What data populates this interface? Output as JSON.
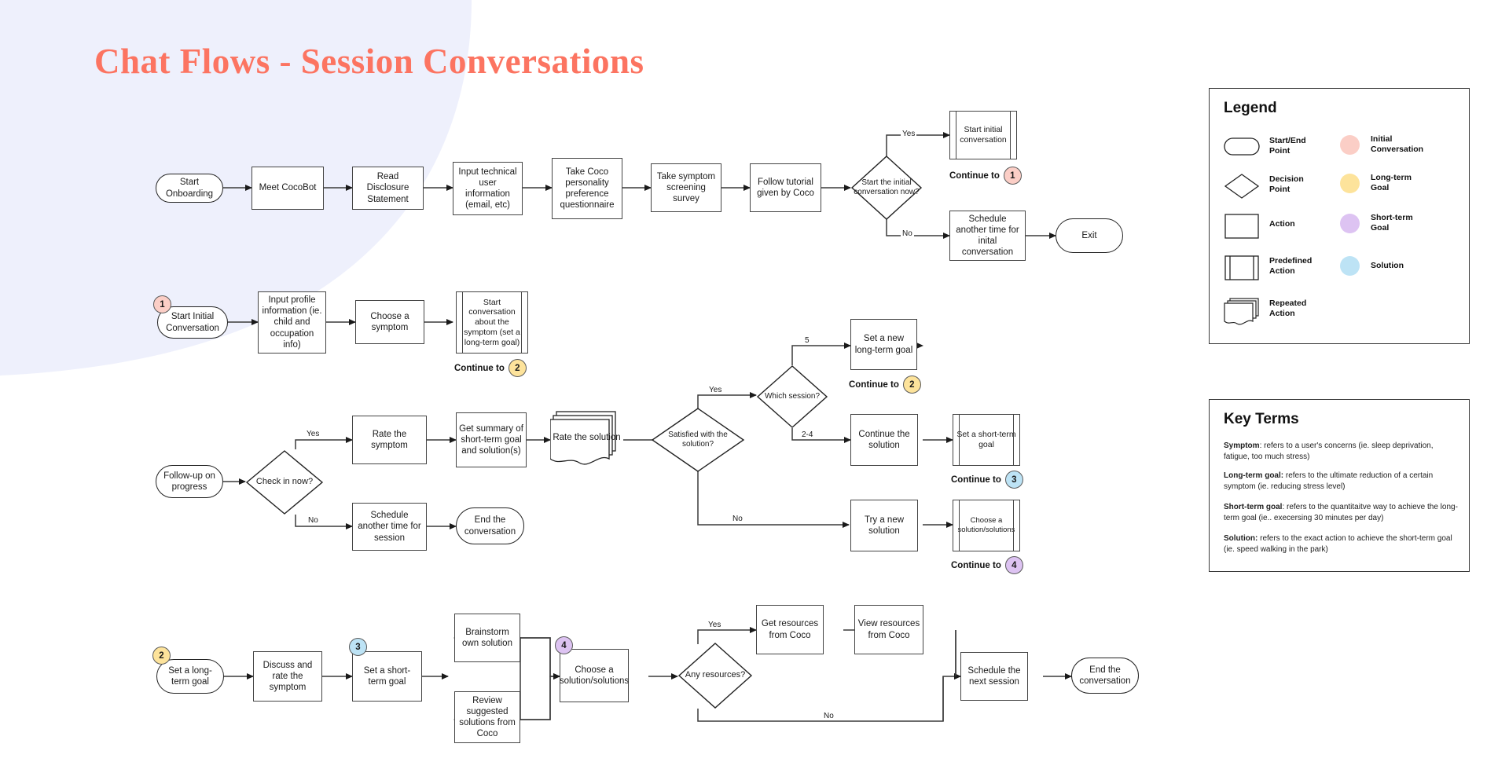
{
  "title": "Chat Flows - Session Conversations",
  "theme": {
    "title_color": "#fc7461",
    "background_blob": "#eef0fc",
    "initial_conversation": "#fbcec6",
    "long_term_goal": "#fde39b",
    "short_term_goal": "#ddc3f2",
    "solution": "#bde3f5"
  },
  "flow1": {
    "nodes": {
      "start_onboarding": "Start Onboarding",
      "meet_cocobot": "Meet CocoBot",
      "read_disclosure": "Read Disclosure Statement",
      "input_technical": "Input technical user information (email, etc)",
      "take_personality": "Take Coco personality preference questionnaire",
      "take_screening": "Take symptom screening survey",
      "follow_tutorial": "Follow tutorial given by Coco",
      "decision_start_initial": "Start the initial conversation now?",
      "start_initial_conversation": "Start initial conversation",
      "schedule_another": "Schedule another time for inital conversation",
      "exit": "Exit"
    },
    "edge_labels": {
      "yes": "Yes",
      "no": "No"
    },
    "continue_label": "Continue to",
    "continue_badge": "1"
  },
  "flow2": {
    "entry_badge": "1",
    "nodes": {
      "start_initial_conversation": "Start Initial Conversation",
      "input_profile": "Input profile information (ie. child and occupation info)",
      "choose_symptom": "Choose a symptom",
      "start_conversation_symptom": "Start conversation about the symptom (set a long-term goal)"
    },
    "continue_label": "Continue to",
    "continue_badge": "2"
  },
  "flow3": {
    "nodes": {
      "followup_progress": "Follow-up on progress",
      "decision_check_in": "Check in now?",
      "rate_symptom": "Rate the symptom",
      "get_summary": "Get summary of short-term goal and solution(s)",
      "rate_solution": "Rate the solution",
      "decision_satisfied": "Satisfied with the solution?",
      "schedule_another_session": "Schedule another time for session",
      "end_conversation": "End the conversation",
      "decision_which_session": "Which session?",
      "set_new_longterm": "Set a new long-term goal",
      "continue_solution": "Continue the solution",
      "set_shortterm": "Set a short-term goal",
      "try_new_solution": "Try a new solution",
      "choose_solutions": "Choose a solution/solutions"
    },
    "edge_labels": {
      "yes": "Yes",
      "no": "No",
      "session_5": "5",
      "session_2_4": "2-4"
    },
    "continue_label": "Continue to",
    "continue_badge_longterm": "2",
    "continue_badge_shortterm": "3",
    "continue_badge_solution": "4"
  },
  "flow4": {
    "entry_badge": "2",
    "shortterm_badge": "3",
    "solution_badge": "4",
    "nodes": {
      "set_longterm_goal": "Set a long-term goal",
      "discuss_rate_symptom": "Discuss and rate the symptom",
      "set_shortterm_goal": "Set a short-term goal",
      "brainstorm_own": "Brainstorm own solution",
      "review_suggested": "Review suggested solutions from Coco",
      "choose_solutions": "Choose a solution/solutions",
      "decision_any_resources": "Any resources?",
      "get_resources": "Get resources from Coco",
      "view_resources": "View resources from Coco",
      "schedule_next_session": "Schedule the next session",
      "end_conversation": "End the conversation"
    },
    "edge_labels": {
      "yes": "Yes",
      "no": "No"
    }
  },
  "legend": {
    "title": "Legend",
    "shapes": [
      {
        "icon": "terminal-shape-icon",
        "label": "Start/End\nPoint"
      },
      {
        "icon": "diamond-shape-icon",
        "label": "Decision\nPoint"
      },
      {
        "icon": "rectangle-shape-icon",
        "label": "Action"
      },
      {
        "icon": "predefined-shape-icon",
        "label": "Predefined\nAction"
      },
      {
        "icon": "repeated-shape-icon",
        "label": "Repeated\nAction"
      }
    ],
    "colors": [
      {
        "icon": "pink-circle-icon",
        "color": "#fbcec6",
        "label": "Initial\nConversation"
      },
      {
        "icon": "yellow-circle-icon",
        "color": "#fde39b",
        "label": "Long-term\nGoal"
      },
      {
        "icon": "purple-circle-icon",
        "color": "#ddc3f2",
        "label": "Short-term\nGoal"
      },
      {
        "icon": "blue-circle-icon",
        "color": "#bde3f5",
        "label": "Solution"
      }
    ]
  },
  "key_terms": {
    "title": "Key Terms",
    "items": [
      {
        "term": "Symptom",
        "sep": ": ",
        "text": "refers to a user's concerns (ie. sleep deprivation, fatigue, too much stress)"
      },
      {
        "term": "Long-term goal:",
        "sep": " ",
        "text": "refers to the ultimate reduction of a certain symptom (ie. reducing stress level)"
      },
      {
        "term": "Short-term goal",
        "sep": ": ",
        "text": "refers to the quantitaitve way to achieve the long-term goal (ie.. execersing 30 minutes per day)"
      },
      {
        "term": "Solution:",
        "sep": " ",
        "text": "refers to the exact action to achieve the short-term goal (ie.  speed walking in the park)"
      }
    ]
  }
}
